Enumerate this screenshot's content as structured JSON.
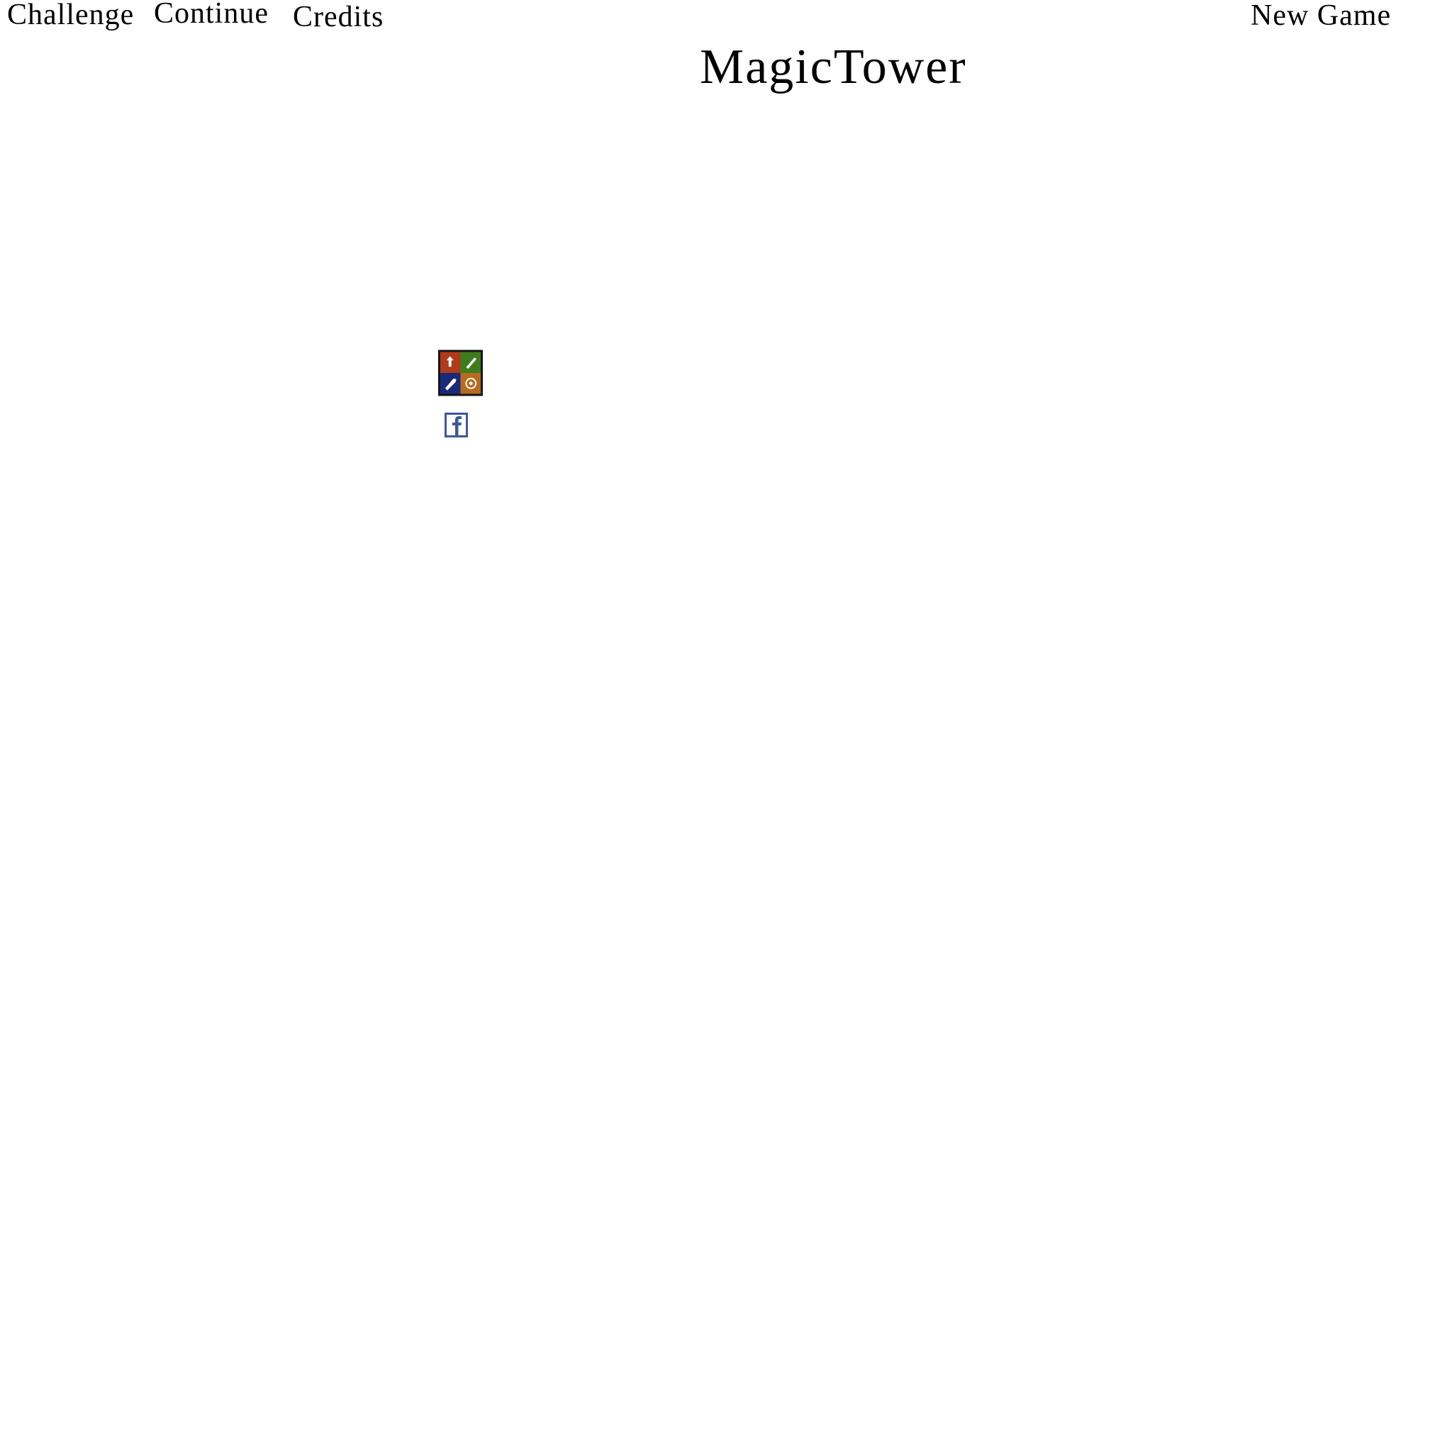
{
  "menu": {
    "challenge_label": "Challenge",
    "continue_label": "Continue",
    "credits_label": "Credits",
    "new_game_label": "New Game"
  },
  "title": "MagicTower",
  "icons": {
    "game_center": "game-center-icon",
    "facebook": "facebook-icon"
  },
  "colors": {
    "background": "#ffffff",
    "text": "#000000",
    "facebook_blue": "#3b5998"
  }
}
